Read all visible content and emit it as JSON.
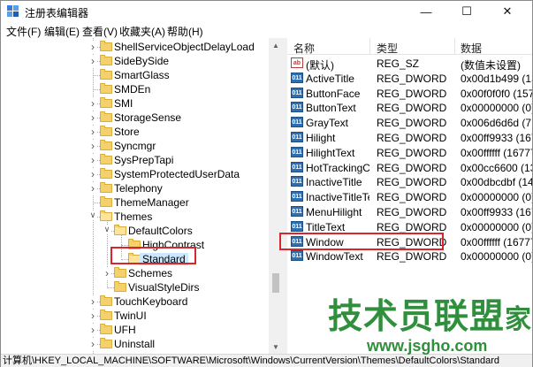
{
  "window": {
    "title": "注册表编辑器",
    "controls": {
      "minimize": "—",
      "maximize": "☐",
      "close": "✕"
    }
  },
  "menu": [
    "文件(F)",
    "编辑(E)",
    "查看(V)",
    "收藏夹(A)",
    "帮助(H)"
  ],
  "tree": {
    "items": [
      {
        "label": "ShellServiceObjectDelayLoad",
        "level": 0,
        "expander": "collapsed"
      },
      {
        "label": "SideBySide",
        "level": 0,
        "expander": "collapsed"
      },
      {
        "label": "SmartGlass",
        "level": 0,
        "expander": "none"
      },
      {
        "label": "SMDEn",
        "level": 0,
        "expander": "none"
      },
      {
        "label": "SMI",
        "level": 0,
        "expander": "collapsed"
      },
      {
        "label": "StorageSense",
        "level": 0,
        "expander": "collapsed"
      },
      {
        "label": "Store",
        "level": 0,
        "expander": "collapsed"
      },
      {
        "label": "Syncmgr",
        "level": 0,
        "expander": "collapsed"
      },
      {
        "label": "SysPrepTapi",
        "level": 0,
        "expander": "collapsed"
      },
      {
        "label": "SystemProtectedUserData",
        "level": 0,
        "expander": "collapsed"
      },
      {
        "label": "Telephony",
        "level": 0,
        "expander": "collapsed"
      },
      {
        "label": "ThemeManager",
        "level": 0,
        "expander": "none"
      },
      {
        "label": "Themes",
        "level": 0,
        "expander": "expanded"
      },
      {
        "label": "DefaultColors",
        "level": 1,
        "expander": "expanded"
      },
      {
        "label": "HighContrast",
        "level": 2,
        "expander": "none"
      },
      {
        "label": "Standard",
        "level": 2,
        "expander": "none",
        "selected": true
      },
      {
        "label": "Schemes",
        "level": 1,
        "expander": "collapsed"
      },
      {
        "label": "VisualStyleDirs",
        "level": 1,
        "expander": "none"
      },
      {
        "label": "TouchKeyboard",
        "level": 0,
        "expander": "collapsed"
      },
      {
        "label": "TwinUI",
        "level": 0,
        "expander": "collapsed"
      },
      {
        "label": "UFH",
        "level": 0,
        "expander": "collapsed"
      },
      {
        "label": "Uninstall",
        "level": 0,
        "expander": "collapsed"
      }
    ]
  },
  "values": {
    "headers": {
      "name": "名称",
      "type": "类型",
      "data": "数据"
    },
    "rows": [
      {
        "icon": "string-value-icon",
        "badge": "ab",
        "name": "(默认)",
        "type": "REG_SZ",
        "data": "(数值未设置)"
      },
      {
        "icon": "dword-value-icon",
        "badge": "011",
        "name": "ActiveTitle",
        "type": "REG_DWORD",
        "data": "0x00d1b499 (137"
      },
      {
        "icon": "dword-value-icon",
        "badge": "011",
        "name": "ButtonFace",
        "type": "REG_DWORD",
        "data": "0x00f0f0f0 (1579"
      },
      {
        "icon": "dword-value-icon",
        "badge": "011",
        "name": "ButtonText",
        "type": "REG_DWORD",
        "data": "0x00000000 (0)"
      },
      {
        "icon": "dword-value-icon",
        "badge": "011",
        "name": "GrayText",
        "type": "REG_DWORD",
        "data": "0x006d6d6d (717"
      },
      {
        "icon": "dword-value-icon",
        "badge": "011",
        "name": "Hilight",
        "type": "REG_DWORD",
        "data": "0x00ff9933 (1675"
      },
      {
        "icon": "dword-value-icon",
        "badge": "011",
        "name": "HilightText",
        "type": "REG_DWORD",
        "data": "0x00ffffff (16777"
      },
      {
        "icon": "dword-value-icon",
        "badge": "011",
        "name": "HotTrackingC...",
        "type": "REG_DWORD",
        "data": "0x00cc6600 (1339"
      },
      {
        "icon": "dword-value-icon",
        "badge": "011",
        "name": "InactiveTitle",
        "type": "REG_DWORD",
        "data": "0x00dbcdbf (144"
      },
      {
        "icon": "dword-value-icon",
        "badge": "011",
        "name": "InactiveTitleText",
        "type": "REG_DWORD",
        "data": "0x00000000 (0)"
      },
      {
        "icon": "dword-value-icon",
        "badge": "011",
        "name": "MenuHilight",
        "type": "REG_DWORD",
        "data": "0x00ff9933 (1675"
      },
      {
        "icon": "dword-value-icon",
        "badge": "011",
        "name": "TitleText",
        "type": "REG_DWORD",
        "data": "0x00000000 (0)"
      },
      {
        "icon": "dword-value-icon",
        "badge": "011",
        "name": "Window",
        "type": "REG_DWORD",
        "data": "0x00ffffff (16777"
      },
      {
        "icon": "dword-value-icon",
        "badge": "011",
        "name": "WindowText",
        "type": "REG_DWORD",
        "data": "0x00000000 (0)"
      }
    ]
  },
  "status": {
    "path": "计算机\\HKEY_LOCAL_MACHINE\\SOFTWARE\\Microsoft\\Windows\\CurrentVersion\\Themes\\DefaultColors\\Standard"
  },
  "watermark": {
    "brand": "技术员联盟",
    "sub": "家",
    "url": "www.jsgho.com"
  },
  "colors": {
    "highlight": "#d9262d",
    "selection": "#cce8ff",
    "folder": "#f6d16b",
    "watermark": "#2f8f3c"
  }
}
